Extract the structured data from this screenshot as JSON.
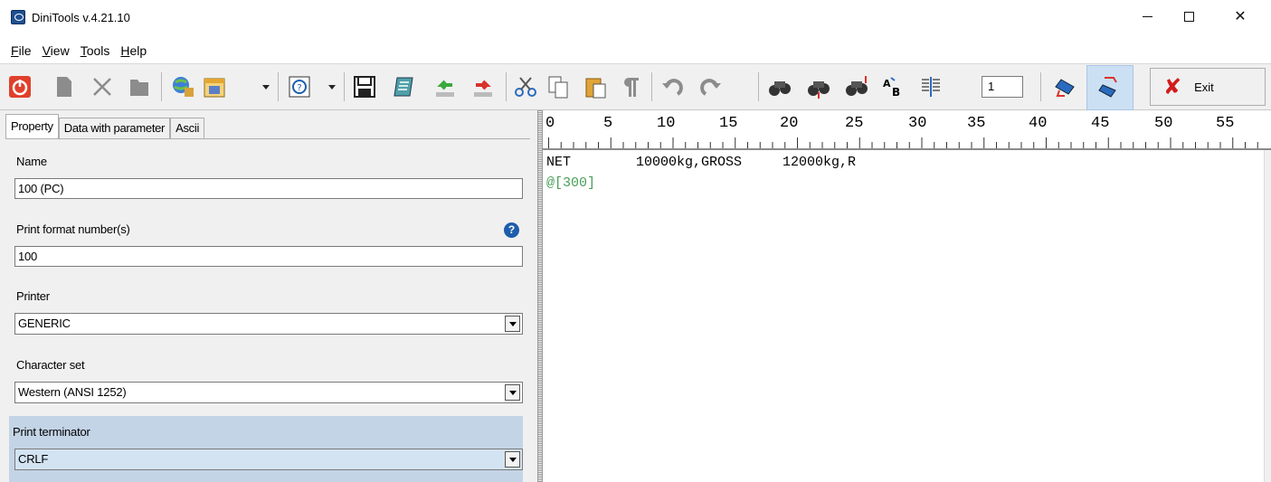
{
  "window": {
    "title": "DiniTools v.4.21.10",
    "minimize_glyph": "—",
    "close_glyph": "✕"
  },
  "menu": [
    {
      "label": "File",
      "accel": "F",
      "rest": "ile"
    },
    {
      "label": "View",
      "accel": "V",
      "rest": "iew"
    },
    {
      "label": "Tools",
      "accel": "T",
      "rest": "ools"
    },
    {
      "label": "Help",
      "accel": "H",
      "rest": "elp"
    }
  ],
  "toolbar": {
    "icons": [
      "power-icon",
      "new-document-icon",
      "delete-icon",
      "open-folder-icon",
      "network-icon",
      "calendar-icon",
      "help-icon",
      "save-icon",
      "notebook-icon",
      "import-icon",
      "export-icon",
      "cut-icon",
      "copy-icon",
      "paste-icon",
      "paragraph-icon",
      "undo-icon",
      "redo-icon",
      "find-icon",
      "find-next-icon",
      "find-replace-icon",
      "replace-text-icon",
      "align-icon",
      "scale-connect-icon",
      "scale-send-icon"
    ],
    "position_value": "1",
    "exit_label": "Exit",
    "accent_red": "#d21b1b"
  },
  "tabs": [
    "Property",
    "Data with parameter",
    "Ascii"
  ],
  "properties": {
    "name_label": "Name",
    "name_value": "100 (PC)",
    "print_format_label": "Print format number(s)",
    "print_format_value": "100",
    "help_glyph": "?",
    "printer_label": "Printer",
    "printer_value": "GENERIC",
    "charset_label": "Character set",
    "charset_value": "Western (ANSI 1252)",
    "terminator_label": "Print terminator",
    "terminator_value": "CRLF"
  },
  "ruler": [
    "0",
    "5",
    "10",
    "15",
    "20",
    "25",
    "30",
    "35",
    "40",
    "45",
    "50",
    "55"
  ],
  "editor": {
    "line1": "NET        10000kg,GROSS     12000kg,R",
    "line2": "@[300]",
    "param_color": "#4aa05a"
  }
}
